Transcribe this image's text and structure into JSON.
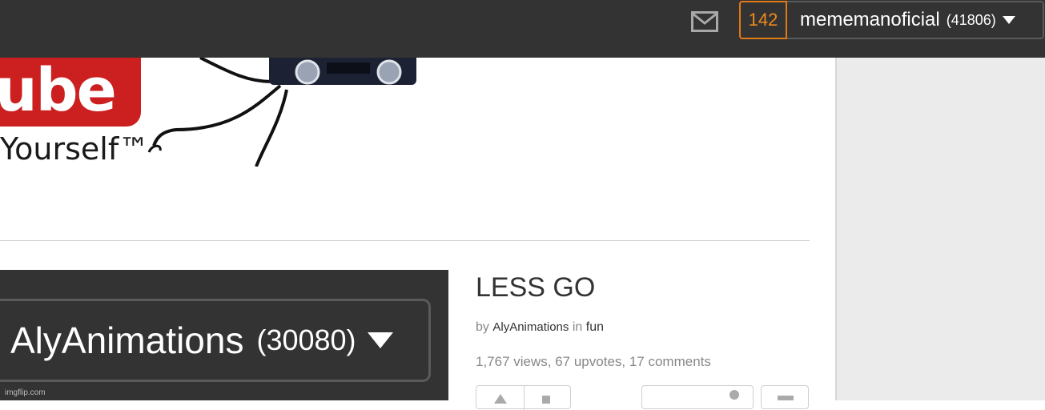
{
  "header": {
    "notification_count": "142",
    "username": "mememanoficial",
    "user_points": "(41806)",
    "icons": {
      "mail": "mail-icon",
      "dropdown": "caret-down-icon"
    },
    "accent_color": "#f08a1c"
  },
  "meme_image": {
    "logo_text": "ube",
    "tagline": "Yourself™"
  },
  "post": {
    "title": "LESS GO",
    "by_label": "by",
    "author": "AlyAnimations",
    "in_label": "in",
    "category": "fun",
    "stats": "1,767 views, 67 upvotes, 17 comments",
    "thumbnail": {
      "username": "AlyAnimations",
      "points": "(30080)",
      "watermark": "imgflip.com"
    }
  }
}
